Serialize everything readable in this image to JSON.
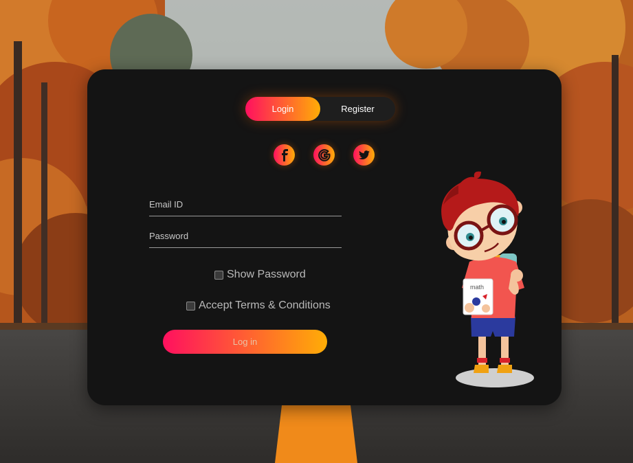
{
  "tabs": {
    "login_label": "Login",
    "register_label": "Register",
    "active": "Login"
  },
  "social": [
    "facebook-icon",
    "google-icon",
    "twitter-icon"
  ],
  "form": {
    "email_placeholder": "Email ID",
    "password_placeholder": "Password",
    "show_password_label": "Show Password",
    "show_password_checked": false,
    "terms_label": "Accept Terms & Conditions",
    "terms_checked": false,
    "submit_label": "Log in"
  },
  "illustration": {
    "book_text": "math"
  },
  "colors": {
    "gradient_start": "#ff105f",
    "gradient_end": "#ffad06",
    "card_bg": "#141414"
  }
}
